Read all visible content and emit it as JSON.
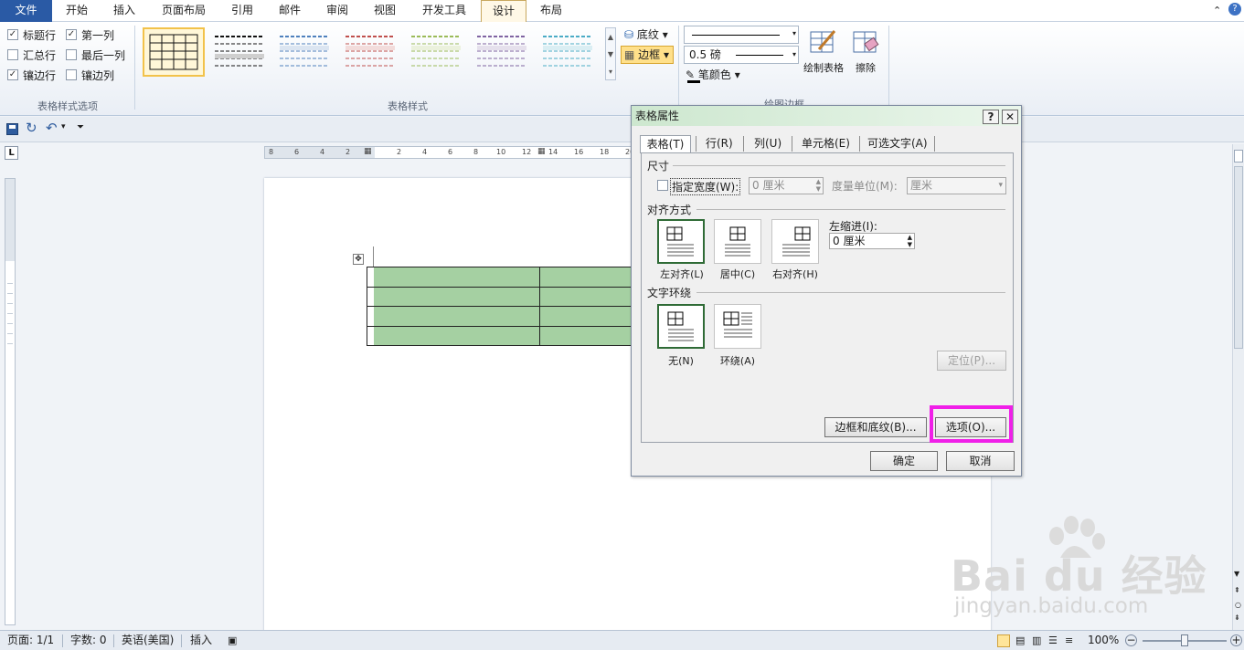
{
  "ribbon": {
    "tabs": [
      {
        "label": "文件",
        "file": true
      },
      {
        "label": "开始"
      },
      {
        "label": "插入"
      },
      {
        "label": "页面布局"
      },
      {
        "label": "引用"
      },
      {
        "label": "邮件"
      },
      {
        "label": "审阅"
      },
      {
        "label": "视图"
      },
      {
        "label": "开发工具"
      },
      {
        "label": "设计",
        "selected": true
      },
      {
        "label": "布局"
      }
    ],
    "style_options": {
      "group_label": "表格样式选项",
      "items": [
        {
          "label": "标题行",
          "checked": true
        },
        {
          "label": "第一列",
          "checked": true
        },
        {
          "label": "汇总行",
          "checked": false
        },
        {
          "label": "最后一列",
          "checked": false
        },
        {
          "label": "镶边行",
          "checked": true
        },
        {
          "label": "镶边列",
          "checked": false
        }
      ]
    },
    "table_styles": {
      "group_label": "表格样式"
    },
    "shading_label": "底纹",
    "borders_label": "边框",
    "draw_borders": {
      "line_weight": "0.5 磅",
      "pen_color_label": "笔颜色",
      "draw_table_label": "绘制表格",
      "eraser_label": "擦除",
      "group_label": "绘图边框"
    }
  },
  "ruler": {
    "ticks": [
      "8",
      "6",
      "4",
      "2",
      "",
      "2",
      "4",
      "6",
      "8",
      "10",
      "12",
      "14",
      "16",
      "18",
      "20"
    ]
  },
  "dialog": {
    "title": "表格属性",
    "help": "?",
    "close": "✕",
    "tabs": [
      "表格(T)",
      "行(R)",
      "列(U)",
      "单元格(E)",
      "可选文字(A)"
    ],
    "size": {
      "section": "尺寸",
      "preferred_width_label": "指定宽度(W):",
      "width_value": "0 厘米",
      "unit_label": "度量单位(M):",
      "unit_value": "厘米"
    },
    "alignment": {
      "section": "对齐方式",
      "options": [
        "左对齐(L)",
        "居中(C)",
        "右对齐(H)"
      ],
      "indent_label": "左缩进(I):",
      "indent_value": "0 厘米"
    },
    "wrapping": {
      "section": "文字环绕",
      "options": [
        "无(N)",
        "环绕(A)"
      ],
      "positioning_button": "定位(P)..."
    },
    "borders_shading_button": "边框和底纹(B)...",
    "options_button": "选项(O)...",
    "ok": "确定",
    "cancel": "取消"
  },
  "status": {
    "page": "页面: 1/1",
    "words": "字数: 0",
    "language": "英语(美国)",
    "mode": "插入",
    "zoom": "100%"
  },
  "watermark": {
    "brand": "Bai du 经验",
    "url": "jingyan.baidu.com"
  },
  "colors": {
    "table_fill": "#a5d0a2",
    "highlight": "#f01fe8",
    "file_tab": "#2a5aa5",
    "dialog_title": "#cde7cf"
  },
  "page_table": {
    "rows": 4,
    "cols": 2
  }
}
